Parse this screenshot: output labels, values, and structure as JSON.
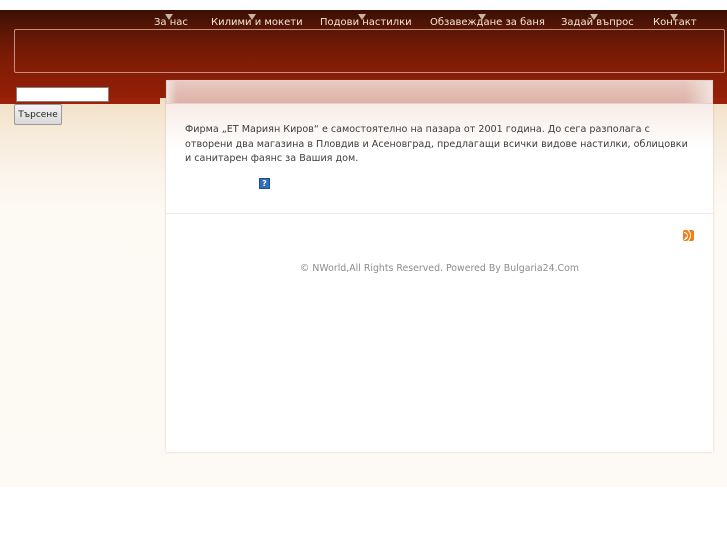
{
  "nav": {
    "items": [
      {
        "label": "За нас"
      },
      {
        "label": "Килими и мокети"
      },
      {
        "label": "Подови настилки"
      },
      {
        "label": "Обзавеждане за баня"
      },
      {
        "label": "Задай въпрос"
      },
      {
        "label": "Контакт"
      }
    ]
  },
  "search": {
    "value": "",
    "button_label": "Търсене"
  },
  "content": {
    "intro": "Фирма „ЕТ Мариян Киров“ е самостоятелно на пазара от 2001 година. До сега разполага с отворени два магазина в Пловдив и Асеновград, предлагащи всички видове настилки, облицовки и санитарен фаянс за Вашия дом.",
    "help_glyph": "?"
  },
  "footer": {
    "copyright": "© NWorld,All Rights Reserved. Powered By Bulgaria24.Com"
  },
  "icons": [
    "help-icon",
    "rss-icon",
    "chevron-down-icon"
  ],
  "colors": {
    "header_dark": "#3a1004",
    "header_red": "#951f07",
    "nav_text": "#f7e8d8",
    "rss": "#f07f18",
    "help": "#2e6fb8"
  }
}
